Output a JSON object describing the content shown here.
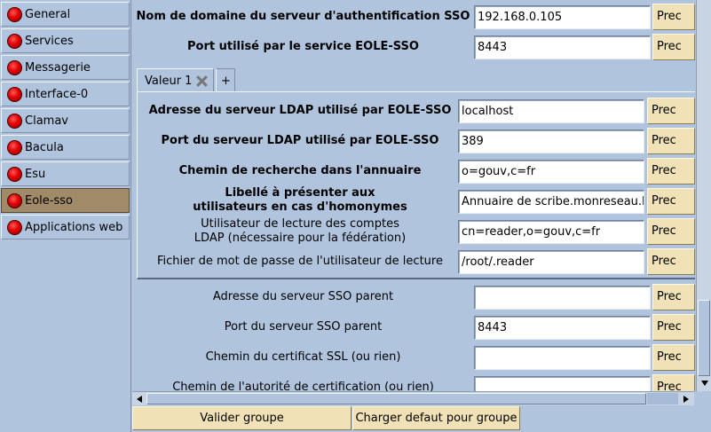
{
  "sidebar": {
    "items": [
      {
        "label": "General",
        "active": false
      },
      {
        "label": "Services",
        "active": false
      },
      {
        "label": "Messagerie",
        "active": false
      },
      {
        "label": "Interface-0",
        "active": false
      },
      {
        "label": "Clamav",
        "active": false
      },
      {
        "label": "Bacula",
        "active": false
      },
      {
        "label": "Esu",
        "active": false
      },
      {
        "label": "Eole-sso",
        "active": true
      },
      {
        "label": "Applications web",
        "active": false
      }
    ],
    "status_icon": "red-circle-icon",
    "status_color": "#e20000",
    "active_color": "#a08a68"
  },
  "top_fields": [
    {
      "label": "Nom de domaine du serveur d'authentification SSO",
      "value": "192.168.0.105",
      "button": "Prec"
    },
    {
      "label": "Port utilisé par le service EOLE-SSO",
      "value": "8443",
      "button": "Prec"
    }
  ],
  "tabs": {
    "active_label": "Valeur 1",
    "close_icon": "close-x-icon",
    "add_label": "+"
  },
  "group_fields": [
    {
      "label": "Adresse du serveur LDAP utilisé par EOLE-SSO",
      "value": "localhost",
      "button": "Prec"
    },
    {
      "label": "Port du serveur LDAP utilisé par EOLE-SSO",
      "value": "389",
      "button": "Prec"
    },
    {
      "label": "Chemin de recherche dans l'annuaire",
      "value": "o=gouv,c=fr",
      "button": "Prec"
    },
    {
      "label_line1": "Libellé à présenter aux",
      "label_line2": "utilisateurs en cas d'homonymes",
      "value": "Annuaire de scribe.monreseau.la",
      "button": "Prec"
    },
    {
      "label_line1": "Utilisateur de lecture des comptes",
      "label_line2": "LDAP (nécessaire pour la fédération)",
      "value": "cn=reader,o=gouv,c=fr",
      "button": "Prec"
    },
    {
      "label": "Fichier de mot de passe de l'utilisateur de lecture",
      "value": "/root/.reader",
      "button": "Prec"
    }
  ],
  "bottom_fields": [
    {
      "label": "Adresse du serveur SSO parent",
      "value": "",
      "button": "Prec"
    },
    {
      "label": "Port du serveur SSO parent",
      "value": "8443",
      "button": "Prec"
    },
    {
      "label": "Chemin du certificat SSL (ou rien)",
      "value": "",
      "button": "Prec"
    },
    {
      "label": "Chemin de l'autorité de certification (ou rien)",
      "value": "",
      "button": "Prec"
    }
  ],
  "buttons": {
    "validate": "Valider groupe",
    "load_default": "Charger defaut pour groupe"
  },
  "colors": {
    "background": "#b0c4de",
    "button": "#f0e2b6"
  }
}
